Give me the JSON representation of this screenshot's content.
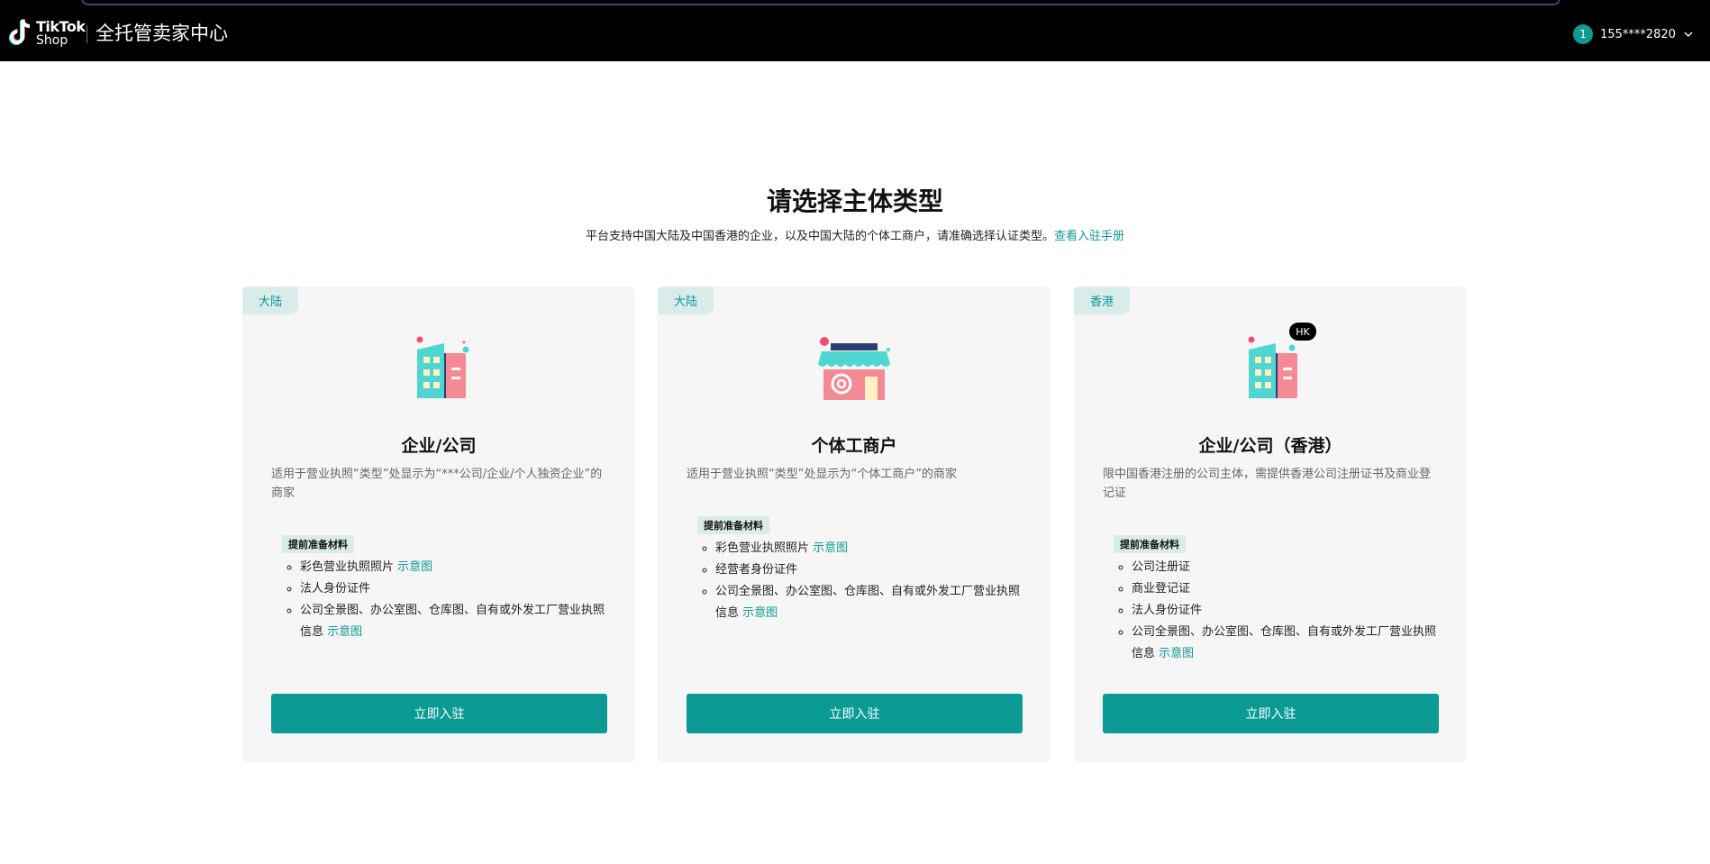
{
  "header": {
    "logo_text": "TikTok",
    "logo_subtext": "Shop",
    "app_title": "全托管卖家中心",
    "user_initial": "1",
    "user_phone": "155****2820"
  },
  "page": {
    "heading": "请选择主体类型",
    "subtitle": "平台支持中国大陆及中国香港的企业，以及中国大陆的个体工商户，请准确选择认证类型。",
    "manual_link": "查看入驻手册"
  },
  "cards": [
    {
      "region_tag": "大陆",
      "title": "企业/公司",
      "desc": "适用于营业执照“类型”处显示为“***公司/企业/个人独资企业”的商家",
      "materials_label": "提前准备材料",
      "materials": [
        {
          "text": "彩色营业执照照片",
          "link": "示意图"
        },
        {
          "text": "法人身份证件",
          "link": ""
        },
        {
          "text": "公司全景图、办公室图、仓库图、自有或外发工厂营业执照信息",
          "link": "示意图"
        }
      ],
      "button": "立即入驻",
      "icon": "building-icon"
    },
    {
      "region_tag": "大陆",
      "title": "个体工商户",
      "desc": "适用于营业执照“类型”处显示为“个体工商户”的商家",
      "materials_label": "提前准备材料",
      "materials": [
        {
          "text": "彩色营业执照照片",
          "link": "示意图"
        },
        {
          "text": "经营者身份证件",
          "link": ""
        },
        {
          "text": "公司全景图、办公室图、仓库图、自有或外发工厂营业执照信息",
          "link": "示意图"
        }
      ],
      "button": "立即入驻",
      "icon": "storefront-icon"
    },
    {
      "region_tag": "香港",
      "title": "企业/公司（香港）",
      "desc": "限中国香港注册的公司主体，需提供香港公司注册证书及商业登记证",
      "materials_label": "提前准备材料",
      "materials": [
        {
          "text": "公司注册证",
          "link": ""
        },
        {
          "text": "商业登记证",
          "link": ""
        },
        {
          "text": "法人身份证件",
          "link": ""
        },
        {
          "text": "公司全景图、办公室图、仓库图、自有或外发工厂营业执照信息",
          "link": "示意图"
        }
      ],
      "button": "立即入驻",
      "icon": "building-hk-icon",
      "icon_badge": "HK"
    }
  ],
  "colors": {
    "accent": "#0b9a94",
    "header_bg": "#000000",
    "card_bg": "#f6f6f6",
    "tag_bg": "#d9ecea"
  }
}
